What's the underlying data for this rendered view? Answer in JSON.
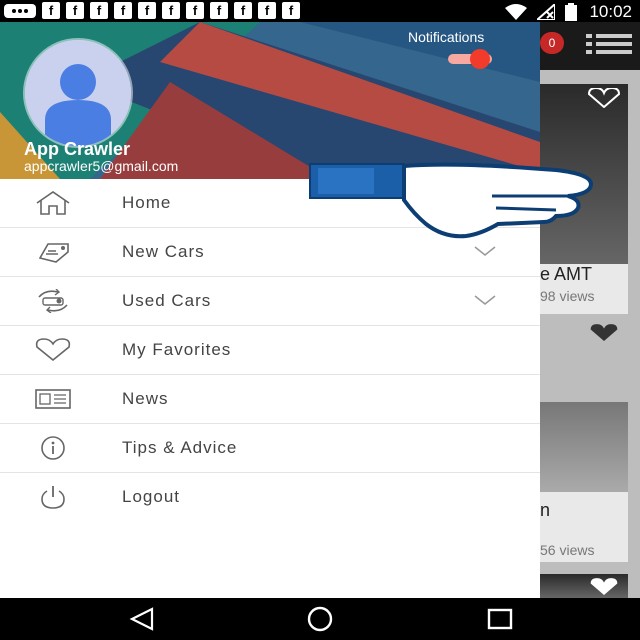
{
  "status_bar": {
    "time": "10:02",
    "notification_icons": [
      "messages-icon",
      "facebook-icon",
      "facebook-icon",
      "facebook-icon",
      "facebook-icon",
      "facebook-icon",
      "facebook-icon",
      "facebook-icon",
      "facebook-icon",
      "facebook-icon",
      "facebook-icon",
      "facebook-icon"
    ],
    "right_icons": [
      "wifi-icon",
      "no-signal-icon",
      "battery-icon"
    ]
  },
  "drawer": {
    "header": {
      "user_name": "App Crawler",
      "user_email": "appcrawler5@gmail.com",
      "notifications_label": "Notifications",
      "notifications_on": true,
      "accent_color": "#f23b2b"
    },
    "menu": [
      {
        "label": "Home",
        "icon": "home-icon",
        "expandable": false
      },
      {
        "label": "New Cars",
        "icon": "car-tag-icon",
        "expandable": true
      },
      {
        "label": "Used Cars",
        "icon": "car-exchange-icon",
        "expandable": true
      },
      {
        "label": "My Favorites",
        "icon": "heart-icon",
        "expandable": false
      },
      {
        "label": "News",
        "icon": "news-icon",
        "expandable": false
      },
      {
        "label": "Tips & Advice",
        "icon": "info-icon",
        "expandable": false
      },
      {
        "label": "Logout",
        "icon": "power-icon",
        "expandable": false
      }
    ]
  },
  "background": {
    "badge_count": "0",
    "card1_title": "e AMT",
    "card1_views": "98 views",
    "card2_title": "n",
    "card2_views": "56 views"
  },
  "nav_bar": {
    "buttons": [
      "back-icon",
      "home-circle-icon",
      "recents-icon"
    ]
  }
}
